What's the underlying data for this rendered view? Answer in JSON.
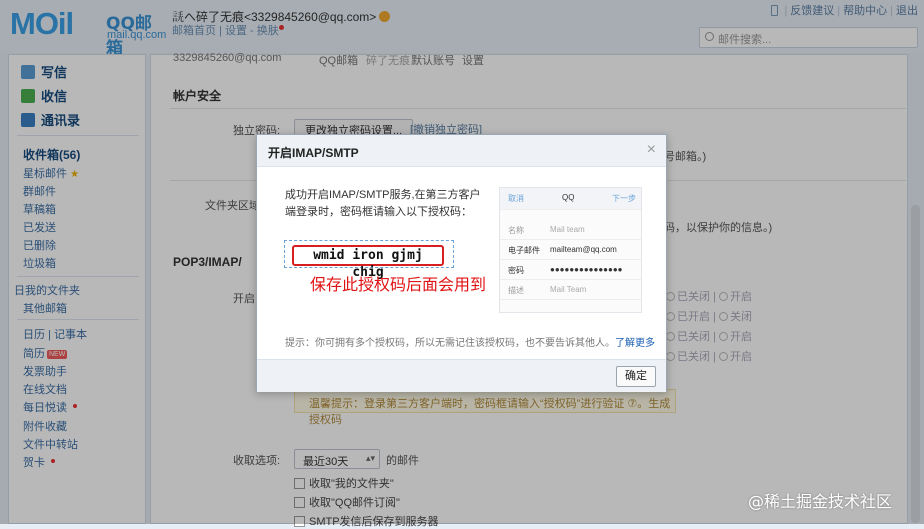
{
  "logo": {
    "big": "MOil",
    "cn": "QQ邮箱",
    "sub": "mail.qq.com"
  },
  "header": {
    "user": "𧧲へ碎了无痕<3329845260@qq.com>",
    "links": [
      "邮箱首页",
      "设置",
      "换肤"
    ],
    "toplinks": [
      "反馈建议",
      "帮助中心",
      "退出"
    ],
    "search_placeholder": "邮件搜索..."
  },
  "sidebar": {
    "compose": "写信",
    "inbox": "收信",
    "contacts": "通讯录",
    "items": [
      "收件箱(56)",
      "星标邮件",
      "群邮件",
      "草稿箱",
      "已发送",
      "已删除",
      "垃圾箱",
      "日我的文件夹",
      "其他邮箱",
      "日历 | 记事本",
      "简历",
      "发票助手",
      "在线文档",
      "每日悦读",
      "附件收藏",
      "文件中转站",
      "贺卡"
    ],
    "new_badge": "NEW"
  },
  "main": {
    "strip": [
      "3329845260@qq.com",
      "QQ邮箱",
      "碎了无痕",
      "默认账号",
      "设置"
    ],
    "account_security": "帐户安全",
    "independent_pwd": "独立密码:",
    "change_pwd_btn": "更改独立密码设置...",
    "cancel_pwd": "[撤销独立密码]",
    "right_text1": "号邮箱。)",
    "folder_label": "文件夹区域",
    "right_text2": "码，以保护你的信息。)",
    "pop_section": "POP3/IMAP/",
    "open_service": "开启",
    "rows": [
      [
        "已关闭",
        "开启"
      ],
      [
        "已开启",
        "关闭"
      ],
      [
        "已关闭",
        "开启"
      ],
      [
        "已关闭",
        "开启"
      ]
    ],
    "warn": "温馨提示：登录第三方客户端时，密码框请输入“授权码”进行验证 ⑦。生成授权码",
    "recv_label": "收取选项:",
    "recv_value": "最近30天",
    "recv_suffix": "的邮件",
    "checks": [
      "收取\"我的文件夹\"",
      "收取\"QQ邮件订阅\"",
      "SMTP发信后保存到服务器"
    ]
  },
  "dialog": {
    "title": "开启IMAP/SMTP",
    "close": "×",
    "message": "成功开启IMAP/SMTP服务,在第三方客户端登录时，密码框请输入以下授权码：",
    "code": "wmid iron gjmj chig",
    "note": "保存此授权码后面会用到",
    "phone": {
      "cancel": "取消",
      "title": "QQ",
      "next": "下一步",
      "rows": [
        [
          "名称",
          "Mail team"
        ],
        [
          "电子邮件",
          "mailteam@qq.com"
        ],
        [
          "密码",
          "●●●●●●●●●●●●●●●"
        ],
        [
          "描述",
          "Mail Team"
        ]
      ]
    },
    "tip": "提示：你可拥有多个授权码，所以无需记住该授权码，也不要告诉其他人。",
    "tip_link": "了解更多",
    "ok": "确定"
  },
  "watermark": "@稀土掘金技术社区"
}
